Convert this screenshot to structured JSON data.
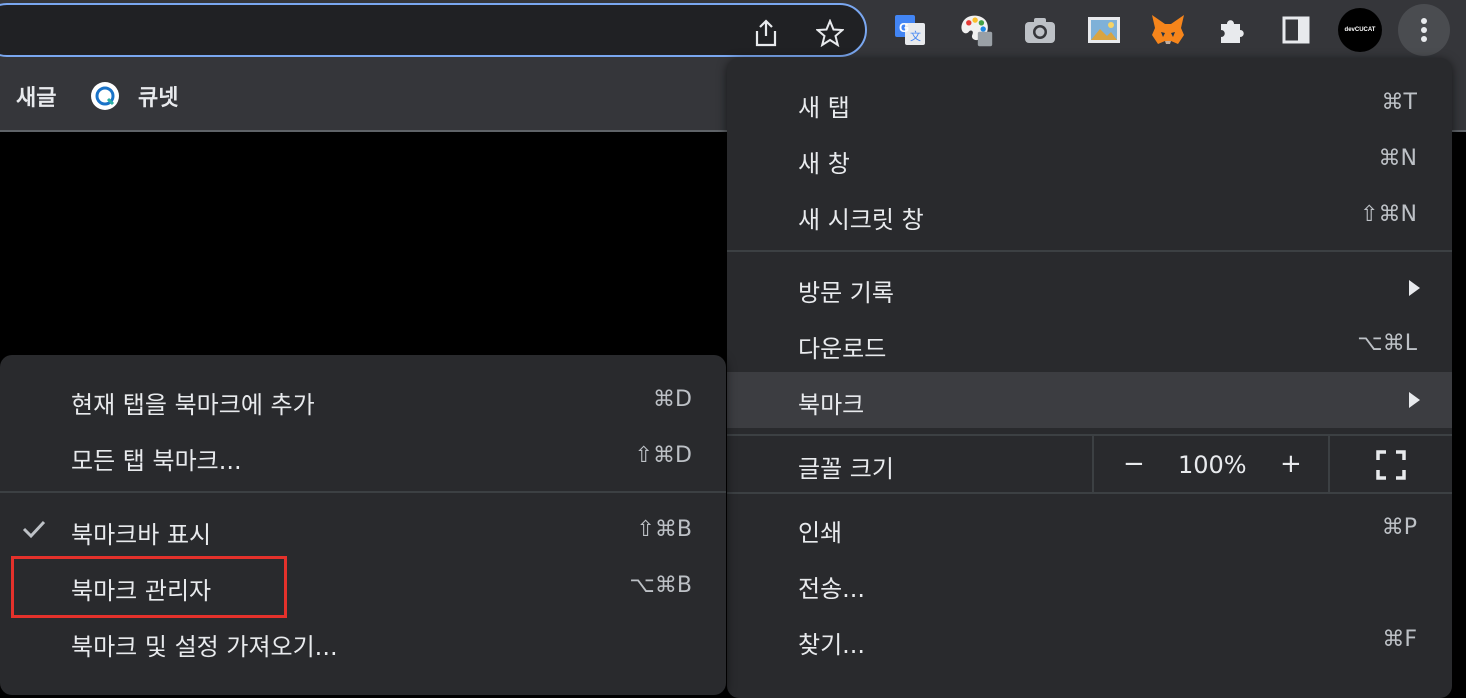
{
  "toolbar": {
    "omnibox_icons": [
      "share-icon",
      "star-icon"
    ],
    "extensions": [
      "google-translate-icon",
      "color-picker-icon",
      "camera-icon",
      "image-icon",
      "metamask-fox-icon",
      "puzzle-extensions-icon",
      "side-panel-icon"
    ],
    "profile_label": "devCUCAT",
    "menu_icon": "three-dots-icon"
  },
  "bookmarks_bar": {
    "items": [
      {
        "label": "새글"
      },
      {
        "label": "큐넷",
        "icon": "qnet-logo-icon"
      }
    ]
  },
  "main_menu": {
    "items": [
      {
        "label": "새 탭",
        "shortcut": "⌘T"
      },
      {
        "label": "새 창",
        "shortcut": "⌘N"
      },
      {
        "label": "새 시크릿 창",
        "shortcut": "⇧⌘N"
      },
      {
        "label": "방문 기록",
        "shortcut": ""
      },
      {
        "label": "다운로드",
        "shortcut": "⌥⌘L"
      },
      {
        "label": "북마크",
        "shortcut": ""
      },
      {
        "label": "글꼴 크기",
        "shortcut": ""
      },
      {
        "label": "인쇄",
        "shortcut": "⌘P"
      },
      {
        "label": "전송...",
        "shortcut": ""
      },
      {
        "label": "찾기...",
        "shortcut": "⌘F"
      }
    ],
    "zoom": {
      "minus": "−",
      "value": "100%",
      "plus": "+"
    }
  },
  "bookmark_submenu": {
    "items": [
      {
        "label": "현재 탭을 북마크에 추가",
        "shortcut": "⌘D"
      },
      {
        "label": "모든 탭 북마크...",
        "shortcut": "⇧⌘D"
      },
      {
        "label": "북마크바 표시",
        "shortcut": "⇧⌘B",
        "checked": true
      },
      {
        "label": "북마크 관리자",
        "shortcut": "⌥⌘B",
        "highlighted_box": true
      },
      {
        "label": "북마크 및 설정 가져오기...",
        "shortcut": ""
      }
    ]
  },
  "colors": {
    "toolbar_bg": "#35363a",
    "menu_bg": "#292a2d",
    "highlight_bg": "#3c3d41",
    "omnibox_border": "#7aa7f0",
    "annotation_red": "#e4312b"
  }
}
